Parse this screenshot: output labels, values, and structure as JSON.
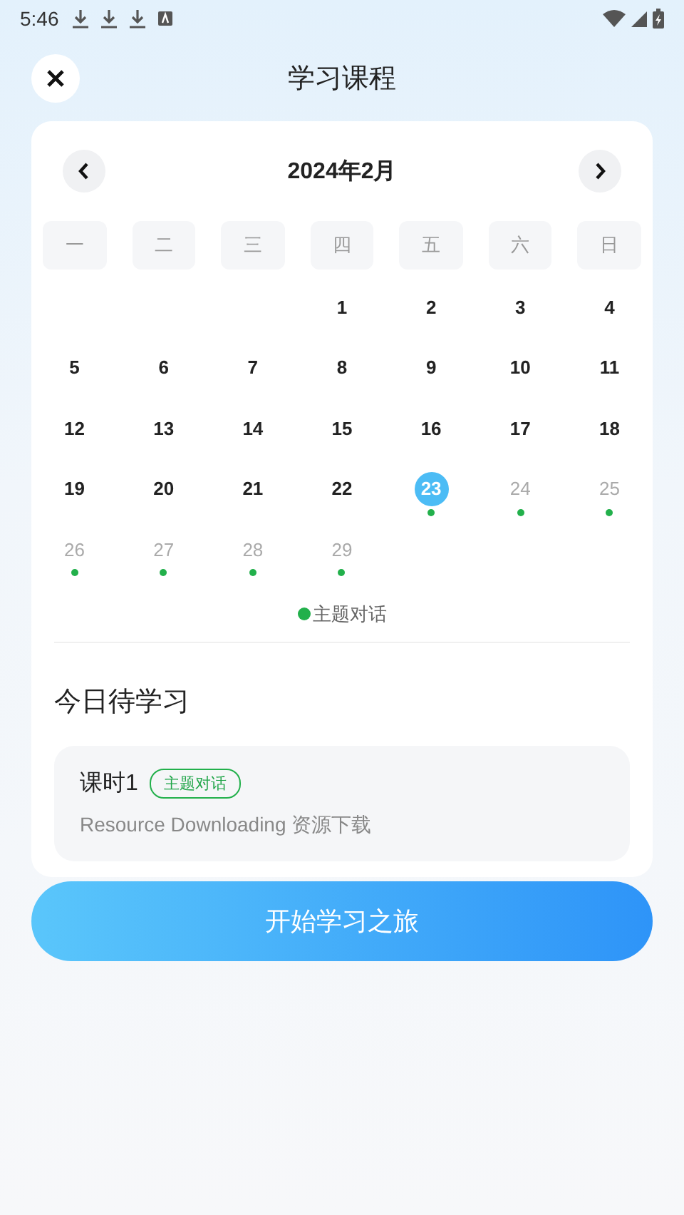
{
  "status_bar": {
    "time": "5:46"
  },
  "header": {
    "title": "学习课程"
  },
  "calendar": {
    "month": "2024年2月",
    "weekdays": [
      "一",
      "二",
      "三",
      "四",
      "五",
      "六",
      "日"
    ],
    "weeks": [
      {
        "align_end": true,
        "days": [
          {
            "day": "1",
            "selected": false,
            "muted": false,
            "marked": false
          },
          {
            "day": "2",
            "selected": false,
            "muted": false,
            "marked": false
          },
          {
            "day": "3",
            "selected": false,
            "muted": false,
            "marked": false
          },
          {
            "day": "4",
            "selected": false,
            "muted": false,
            "marked": false
          }
        ]
      },
      {
        "days": [
          {
            "day": "5",
            "selected": false,
            "muted": false,
            "marked": false
          },
          {
            "day": "6",
            "selected": false,
            "muted": false,
            "marked": false
          },
          {
            "day": "7",
            "selected": false,
            "muted": false,
            "marked": false
          },
          {
            "day": "8",
            "selected": false,
            "muted": false,
            "marked": false
          },
          {
            "day": "9",
            "selected": false,
            "muted": false,
            "marked": false
          },
          {
            "day": "10",
            "selected": false,
            "muted": false,
            "marked": false
          },
          {
            "day": "11",
            "selected": false,
            "muted": false,
            "marked": false
          }
        ]
      },
      {
        "days": [
          {
            "day": "12",
            "selected": false,
            "muted": false,
            "marked": false
          },
          {
            "day": "13",
            "selected": false,
            "muted": false,
            "marked": false
          },
          {
            "day": "14",
            "selected": false,
            "muted": false,
            "marked": false
          },
          {
            "day": "15",
            "selected": false,
            "muted": false,
            "marked": false
          },
          {
            "day": "16",
            "selected": false,
            "muted": false,
            "marked": false
          },
          {
            "day": "17",
            "selected": false,
            "muted": false,
            "marked": false
          },
          {
            "day": "18",
            "selected": false,
            "muted": false,
            "marked": false
          }
        ]
      },
      {
        "days": [
          {
            "day": "19",
            "selected": false,
            "muted": false,
            "marked": false
          },
          {
            "day": "20",
            "selected": false,
            "muted": false,
            "marked": false
          },
          {
            "day": "21",
            "selected": false,
            "muted": false,
            "marked": false
          },
          {
            "day": "22",
            "selected": false,
            "muted": false,
            "marked": false
          },
          {
            "day": "23",
            "selected": true,
            "muted": false,
            "marked": true
          },
          {
            "day": "24",
            "selected": false,
            "muted": true,
            "marked": true
          },
          {
            "day": "25",
            "selected": false,
            "muted": true,
            "marked": true
          }
        ]
      },
      {
        "days": [
          {
            "day": "26",
            "selected": false,
            "muted": true,
            "marked": true
          },
          {
            "day": "27",
            "selected": false,
            "muted": true,
            "marked": true
          },
          {
            "day": "28",
            "selected": false,
            "muted": true,
            "marked": true
          },
          {
            "day": "29",
            "selected": false,
            "muted": true,
            "marked": true
          }
        ]
      }
    ],
    "legend": [
      {
        "label": "主题对话",
        "color": "#22b04b"
      }
    ]
  },
  "today": {
    "heading": "今日待学习",
    "lessons": [
      {
        "title": "课时1",
        "tag": "主题对话",
        "subtitle": "Resource Downloading 资源下载"
      }
    ]
  },
  "start_button": "开始学习之旅"
}
